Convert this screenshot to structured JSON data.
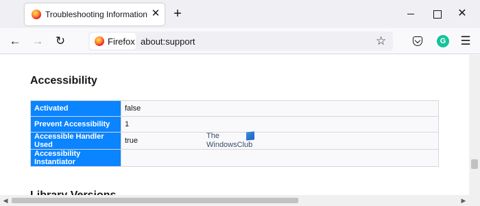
{
  "tab": {
    "title": "Troubleshooting Information",
    "favicon": "firefox-icon",
    "close_glyph": "✕"
  },
  "newtab_glyph": "+",
  "window_controls": {
    "close_glyph": "✕"
  },
  "toolbar": {
    "back_glyph": "←",
    "forward_glyph": "→",
    "reload_glyph": "↻",
    "identity_label": "Firefox",
    "url": "about:support",
    "bookmark_glyph": "☆",
    "extension_letter": "G",
    "menu_glyph": "☰"
  },
  "content": {
    "section_title": "Accessibility",
    "rows": [
      {
        "label": "Activated",
        "value": "false"
      },
      {
        "label": "Prevent Accessibility",
        "value": "1"
      },
      {
        "label": "Accessible Handler Used",
        "value": "true"
      },
      {
        "label": "Accessibility Instantiator",
        "value": ""
      }
    ],
    "next_section_title": "Library Versions"
  },
  "watermark": {
    "line1": "The",
    "line2": "WindowsClub"
  },
  "colors": {
    "header_cell": "#0a84ff",
    "accent": "#0a84ff",
    "grammarly": "#15c39a"
  }
}
